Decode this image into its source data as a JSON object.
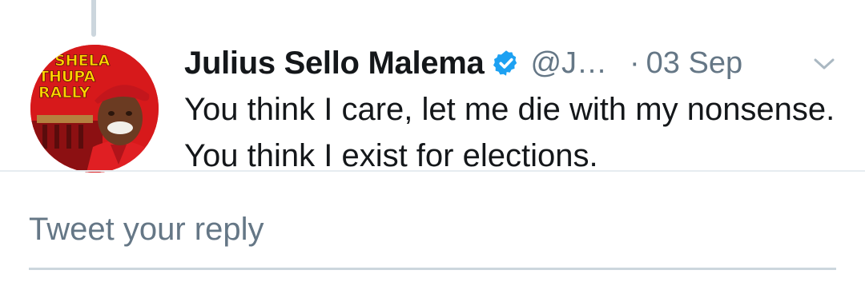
{
  "tweet": {
    "display_name": "Julius Sello Malema",
    "handle": "@J…",
    "separator_dot": "·",
    "date": "03 Sep",
    "text": "You think I care, let me die with my nonsense. You think I exist for elections.",
    "verified": true
  },
  "avatar": {
    "lettering": [
      "SHELA",
      "THUPA",
      "RALLY"
    ],
    "background_color": "#d7191b"
  },
  "reply": {
    "placeholder": "Tweet your reply"
  },
  "colors": {
    "name": "#14171a",
    "secondary": "#657786",
    "verified_blue": "#1da1f2",
    "divider": "#e6ecf0",
    "thread_line": "#ccd6dd"
  },
  "icons": {
    "verified": "verified-badge-icon",
    "menu": "chevron-down-icon"
  }
}
